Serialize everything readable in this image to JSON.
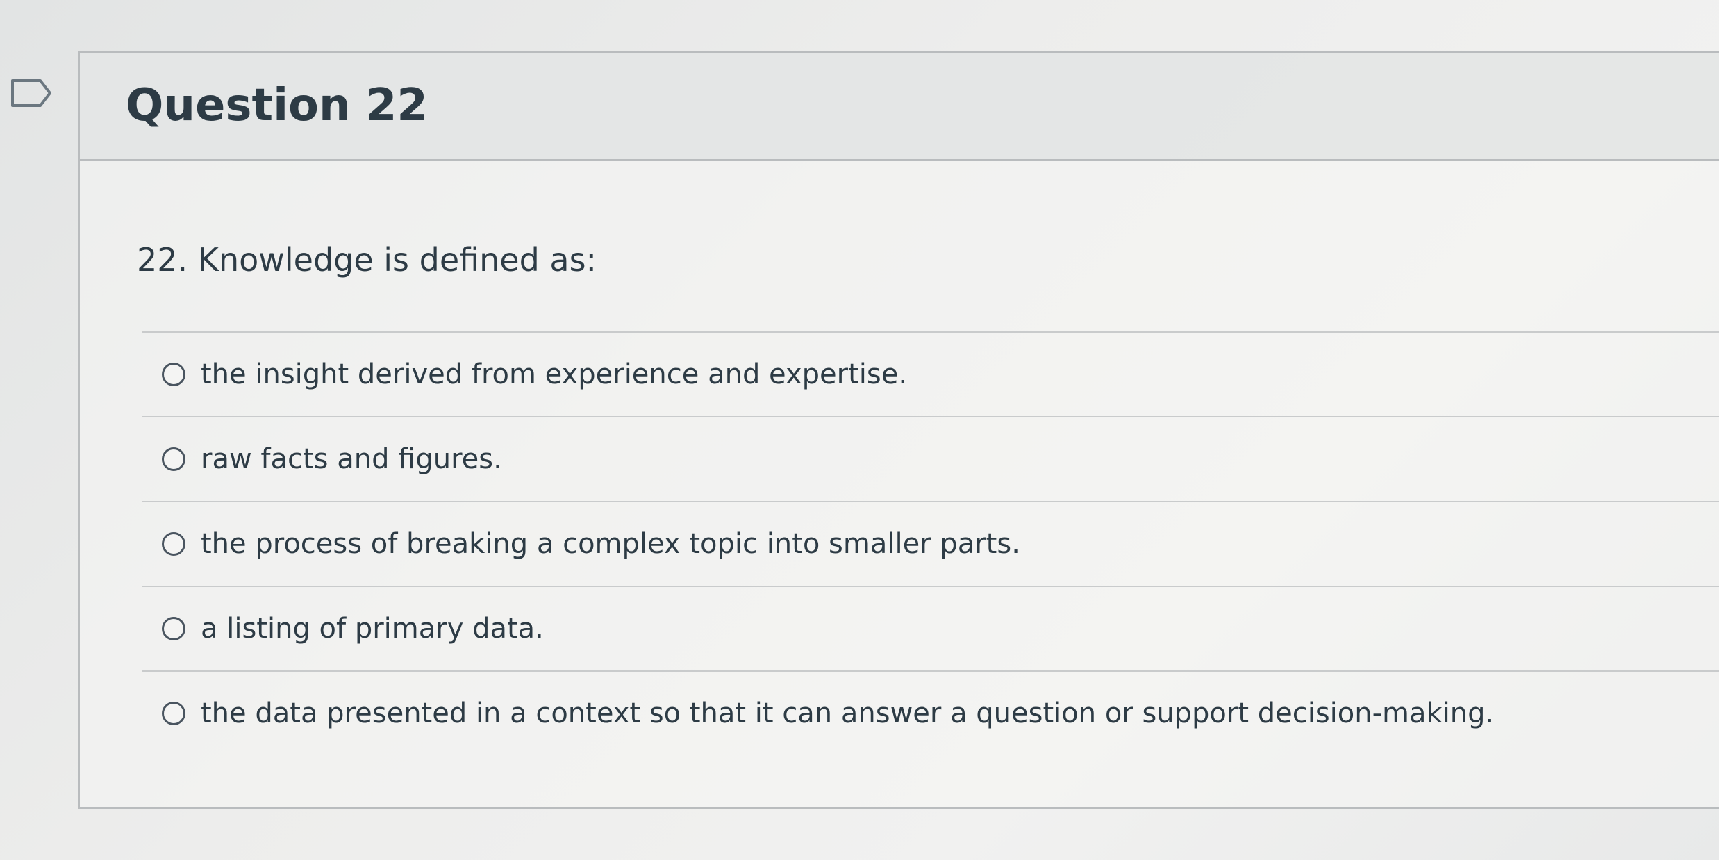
{
  "question": {
    "title": "Question 22",
    "text": "22. Knowledge is defined as:",
    "flag_icon": "bookmark-flag-icon"
  },
  "answers": [
    {
      "label": "the insight derived from experience and expertise.",
      "selected": false
    },
    {
      "label": "raw facts and figures.",
      "selected": false
    },
    {
      "label": "the process of breaking a complex topic into smaller parts.",
      "selected": false
    },
    {
      "label": "a listing of primary data.",
      "selected": false
    },
    {
      "label": "the data presented in a context so that it can answer a question or support decision-making.",
      "selected": false
    }
  ],
  "colors": {
    "text": "#2d3b45",
    "border": "#b9bcbe",
    "radio": "#4a5560"
  }
}
